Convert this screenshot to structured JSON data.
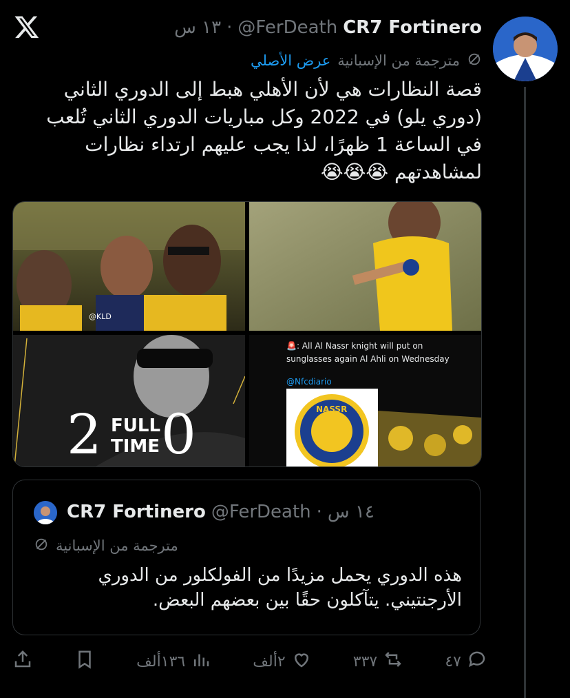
{
  "tweet": {
    "display_name": "CR7 Fortinero",
    "handle": "@FerDeath",
    "dot": "·",
    "time": "١٣ س",
    "translated_label": "مترجمة من الإسبانية",
    "show_original": "عرض الأصلي",
    "text_lines": [
      "قصة النظارات هي لأن الأهلي هبط إلى الدوري الثاني",
      "(دوري يلو) في 2022 وكل مباريات الدوري الثاني تُلعب",
      "في الساعة 1 ظهرًا، لذا يجب عليهم ارتداء نظارات",
      "لمشاهدتهم 😭😭😭"
    ]
  },
  "media": {
    "photo1_watermark": "@KLD",
    "photo4_line1": "🚨: All Al Nassr knight will put on",
    "photo4_line2": "sunglasses  again Al Ahli on Wednesday",
    "photo4_handle": "@Nfcdiario",
    "photo4_logo_text": "NASSR",
    "score_home": "2",
    "score_away": "0",
    "full": "FULL",
    "time_word": "TIME"
  },
  "quote": {
    "display_name": "CR7 Fortinero",
    "handle": "@FerDeath",
    "dot": "·",
    "time": "١٤ س",
    "translated_label": "مترجمة من الإسبانية",
    "text_lines": [
      "هذه الدوري يحمل مزيدًا من الفولكلور من الدوري",
      "الأرجنتيني. يتآكلون حقًا بين بعضهم البعض."
    ]
  },
  "actions": {
    "replies": "٤٧",
    "reposts": "٣٣٧",
    "likes": "٢ألف",
    "views": "١٣٦ألف"
  },
  "colors": {
    "background": "#000000",
    "text": "#e7e9ea",
    "muted": "#71767b",
    "link": "#1d9bf0",
    "border": "#2f3336",
    "nassr_yellow": "#f2c521",
    "nassr_blue": "#1b3f8f"
  },
  "icons": [
    "x-logo-icon",
    "translate-icon",
    "reply-icon",
    "repost-icon",
    "like-icon",
    "views-icon",
    "bookmark-icon",
    "share-icon"
  ]
}
